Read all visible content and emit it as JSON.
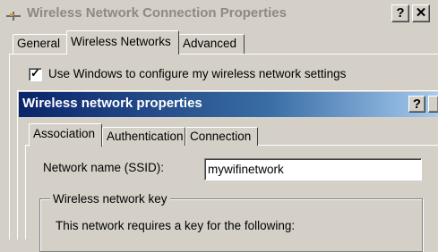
{
  "outer_window": {
    "title": "Wireless Network Connection Properties",
    "help_button": "?",
    "close_button": "✕",
    "tabs": [
      {
        "label": "General"
      },
      {
        "label": "Wireless Networks",
        "selected": true
      },
      {
        "label": "Advanced"
      }
    ],
    "use_windows_checkbox": {
      "label": "Use Windows to configure my wireless network settings",
      "checked": true,
      "mark": "✓"
    }
  },
  "inner_dialog": {
    "title": "Wireless network properties",
    "help_button": "?",
    "close_button": "✕",
    "tabs": [
      {
        "label": "Association",
        "selected": true
      },
      {
        "label": "Authentication"
      },
      {
        "label": "Connection"
      }
    ],
    "ssid": {
      "label": "Network name (SSID):",
      "value": "mywifinetwork"
    },
    "key_group": {
      "legend": "Wireless network key",
      "text": "This network requires a key for the following:"
    }
  },
  "colors": {
    "face": "#d4d0c8",
    "title_active_start": "#0a246a",
    "title_active_end": "#a6caf0",
    "title_inactive_text": "#8e8a82"
  },
  "icons": {
    "outer_window_icon": "network-connection-icon",
    "checkmark": "checkmark-icon"
  }
}
